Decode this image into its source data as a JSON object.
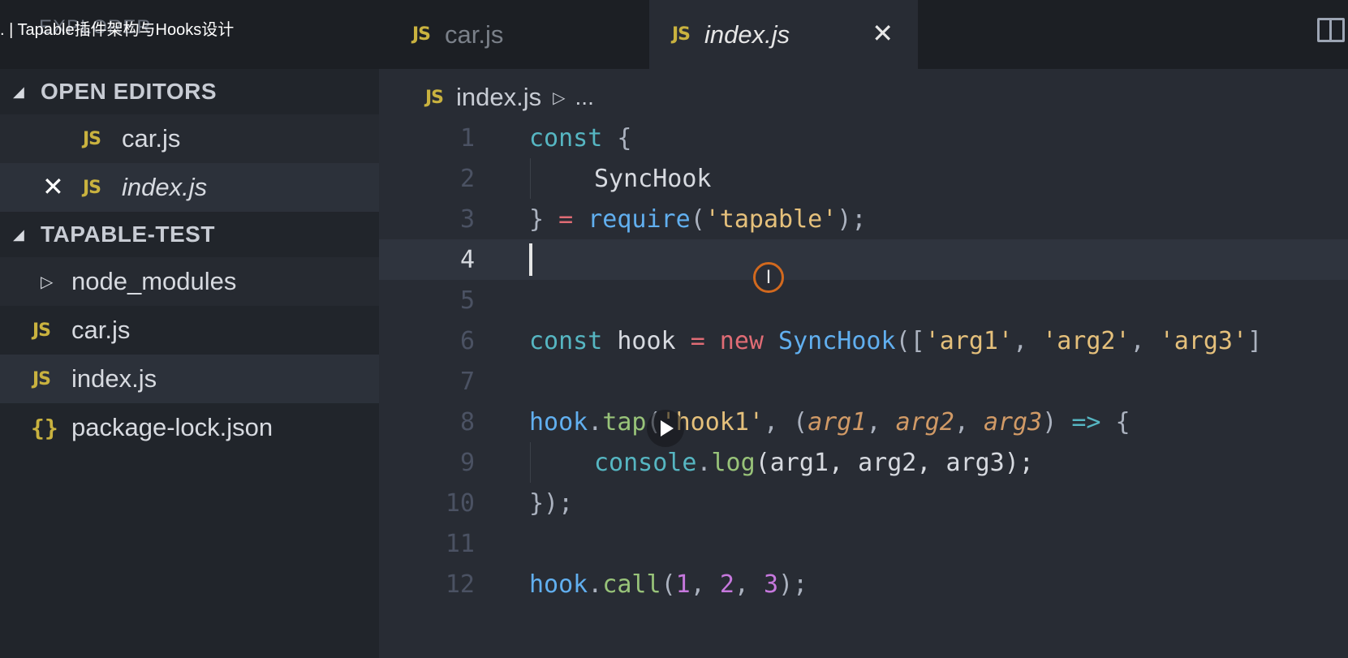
{
  "video_title": ". | Tapable插件架构与Hooks设计",
  "explorer_label": "EXPLORER",
  "tabs": [
    {
      "icon": "JS",
      "label": "car.js",
      "active": false
    },
    {
      "icon": "JS",
      "label": "index.js",
      "active": true,
      "close": "✕"
    }
  ],
  "sidebar": {
    "open_editors": {
      "title": "OPEN EDITORS",
      "items": [
        {
          "icon": "JS",
          "label": "car.js"
        },
        {
          "icon": "JS",
          "label": "index.js",
          "close": "✕"
        }
      ]
    },
    "project": {
      "title": "TAPABLE-TEST",
      "items": [
        {
          "label": "node_modules",
          "type": "folder"
        },
        {
          "icon": "JS",
          "label": "car.js"
        },
        {
          "icon": "JS",
          "label": "index.js"
        },
        {
          "icon": "{}",
          "label": "package-lock.json"
        }
      ]
    }
  },
  "breadcrumb": {
    "icon": "JS",
    "file": "index.js",
    "rest": "..."
  },
  "editor": {
    "current_line": 4,
    "line_numbers": [
      "1",
      "2",
      "3",
      "4",
      "5",
      "6",
      "7",
      "8",
      "9",
      "10",
      "11",
      "12"
    ],
    "code": {
      "l1": {
        "const": "const",
        "brace": " {"
      },
      "l2": {
        "ident": "SyncHook"
      },
      "l3": {
        "close": "} ",
        "eq": "=",
        "req": " require",
        "p1": "(",
        "str": "'tapable'",
        "p2": ");"
      },
      "l6": {
        "const": "const",
        "hook": " hook ",
        "eq": "=",
        "new": " new",
        "cls": " SyncHook",
        "p1": "([",
        "s1": "'arg1'",
        "c1": ", ",
        "s2": "'arg2'",
        "c2": ", ",
        "s3": "'arg3'",
        "p2": "]"
      },
      "l8": {
        "obj": "hook",
        "dot": ".",
        "m": "tap",
        "p1": "(",
        "s": "'hook1'",
        "c": ", (",
        "a1": "arg1",
        "c1": ", ",
        "a2": "arg2",
        "c2": ", ",
        "a3": "arg3",
        "p2": ") ",
        "arrow": "=>",
        "brace": " {"
      },
      "l9": {
        "obj": "console",
        "dot": ".",
        "m": "log",
        "args": "(arg1, arg2, arg3);"
      },
      "l10": {
        "close": "});"
      },
      "l12": {
        "obj": "hook",
        "dot": ".",
        "m": "call",
        "p1": "(",
        "n1": "1",
        "c1": ", ",
        "n2": "2",
        "c2": ", ",
        "n3": "3",
        "p2": ");"
      }
    }
  },
  "colors": {
    "keyword": "#56b6c2",
    "string": "#e5c07b",
    "operator": "#e06c75",
    "number": "#c678dd",
    "js_icon": "#c9b23f"
  }
}
